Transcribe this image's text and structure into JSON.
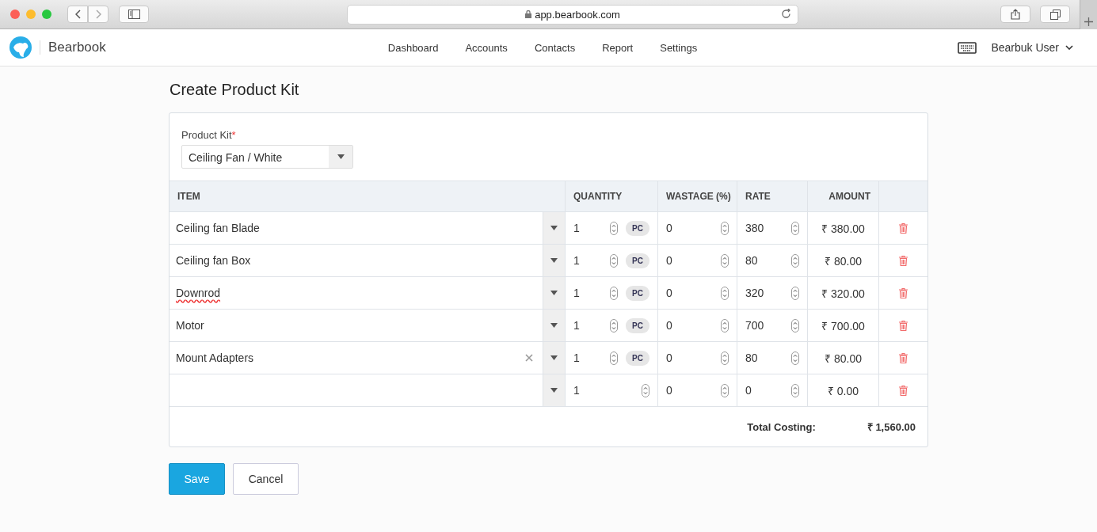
{
  "browser": {
    "url": "app.bearbook.com"
  },
  "nav": {
    "brand": "Bearbook",
    "links": [
      {
        "label": "Dashboard",
        "selected": false
      },
      {
        "label": "Accounts",
        "selected": false
      },
      {
        "label": "Contacts",
        "selected": false
      },
      {
        "label": "Report",
        "selected": false
      },
      {
        "label": "Settings",
        "selected": false
      }
    ],
    "user": "Bearbuk User"
  },
  "page": {
    "title": "Create Product Kit"
  },
  "form": {
    "product_kit": {
      "label": "Product Kit",
      "required_mark": "*",
      "value": "Ceiling Fan / White"
    }
  },
  "table": {
    "columns": [
      "ITEM",
      "QUANTITY",
      "WASTAGE (%)",
      "RATE",
      "AMOUNT"
    ],
    "rows": [
      {
        "item": "Ceiling fan Blade",
        "misspelled": false,
        "clearable": false,
        "quantity": "1",
        "unit": "PC",
        "wastage": "0",
        "rate": "380",
        "amount": "₹ 380.00"
      },
      {
        "item": "Ceiling fan Box",
        "misspelled": false,
        "clearable": false,
        "quantity": "1",
        "unit": "PC",
        "wastage": "0",
        "rate": "80",
        "amount": "₹ 80.00"
      },
      {
        "item": "Downrod",
        "misspelled": true,
        "clearable": false,
        "quantity": "1",
        "unit": "PC",
        "wastage": "0",
        "rate": "320",
        "amount": "₹ 320.00"
      },
      {
        "item": "Motor",
        "misspelled": false,
        "clearable": false,
        "quantity": "1",
        "unit": "PC",
        "wastage": "0",
        "rate": "700",
        "amount": "₹ 700.00"
      },
      {
        "item": "Mount Adapters",
        "misspelled": false,
        "clearable": true,
        "quantity": "1",
        "unit": "PC",
        "wastage": "0",
        "rate": "80",
        "amount": "₹ 80.00"
      },
      {
        "clearable": false,
        "quantity": "1",
        "wastage": "0",
        "rate": "0",
        "amount": "₹ 0.00"
      }
    ],
    "total_label": "Total Costing:",
    "total": "₹ 1,560.00"
  },
  "buttons": [
    {
      "label": "Save",
      "kind": "primary"
    },
    {
      "label": "Cancel",
      "kind": "secondary"
    }
  ]
}
